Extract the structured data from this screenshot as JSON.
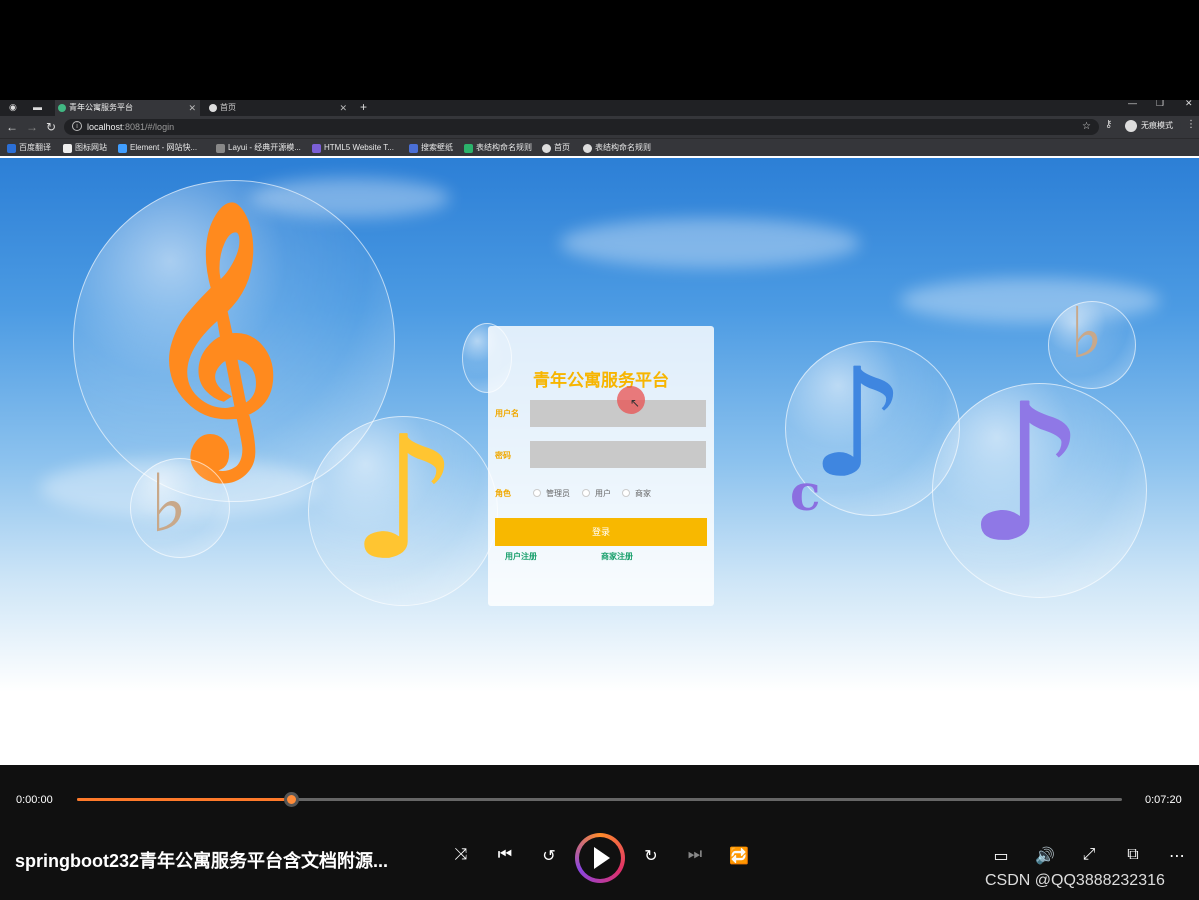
{
  "browser": {
    "tabs": [
      {
        "label": "青年公寓服务平台",
        "active": true
      },
      {
        "label": "首页",
        "active": false
      }
    ],
    "url_host": "localhost",
    "url_rest": ":8081/#/login",
    "profile_label": "无痕模式",
    "bookmarks": [
      "百度翻译",
      "图标网站",
      "Element - 网站快...",
      "Layui - 经典开源模...",
      "HTML5 Website T...",
      "搜索壁纸",
      "表结构命名规则",
      "首页",
      "表结构命名规则"
    ]
  },
  "login": {
    "title": "青年公寓服务平台",
    "username_label": "用户名",
    "password_label": "密码",
    "role_label": "角色",
    "roles": [
      "管理员",
      "用户",
      "商家"
    ],
    "submit_label": "登录",
    "register_user": "用户注册",
    "register_merchant": "商家注册"
  },
  "player": {
    "current_time": "0:00:00",
    "duration": "0:07:20",
    "progress": 0.205,
    "title": "springboot232青年公寓服务平台含文档附源...",
    "watermark": "CSDN @QQ3888232316"
  },
  "colors": {
    "accent": "#f8b800",
    "link": "#1aa06d",
    "progress": "#ff7a2a"
  }
}
